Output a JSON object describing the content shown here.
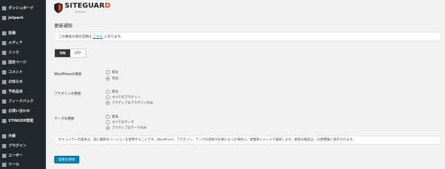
{
  "sidebar": {
    "items": [
      {
        "label": "ダッシュボード",
        "icon": "dashboard-icon"
      },
      {
        "label": "Jetpack",
        "icon": "jetpack-icon"
      },
      {
        "label": "投稿",
        "icon": "pin-icon"
      },
      {
        "label": "メディア",
        "icon": "media-icon"
      },
      {
        "label": "リンク",
        "icon": "link-icon"
      },
      {
        "label": "固定ページ",
        "icon": "page-icon"
      },
      {
        "label": "コメント",
        "icon": "comment-icon"
      },
      {
        "label": "お知らせ",
        "icon": "pin-icon"
      },
      {
        "label": "予約品目",
        "icon": "pin-icon"
      },
      {
        "label": "フィードバック",
        "icon": "feedback-icon"
      },
      {
        "label": "お問い合わせ",
        "icon": "mail-icon"
      },
      {
        "label": "STINGER管理",
        "icon": "settings-icon"
      },
      {
        "label": "外観",
        "icon": "brush-icon"
      },
      {
        "label": "プラグイン",
        "icon": "plugin-icon"
      },
      {
        "label": "ユーザー",
        "icon": "user-icon"
      },
      {
        "label": "ツール",
        "icon": "tools-icon"
      }
    ]
  },
  "logo": {
    "brand_main": "SITEGUAR",
    "brand_last": "D",
    "sub": "WP Plugin"
  },
  "page": {
    "title": "更新通知",
    "info_prefix": "この機能の操作説明は",
    "info_link": "こちら",
    "info_suffix": "にあります。"
  },
  "toggle": {
    "on": "ON",
    "off": "OFF",
    "selected": "ON"
  },
  "sections": {
    "wordpress": {
      "label": "WordPressの更新",
      "options": [
        {
          "label": "無効",
          "checked": false
        },
        {
          "label": "有効",
          "checked": true
        }
      ]
    },
    "plugin": {
      "label": "プラグインの更新",
      "options": [
        {
          "label": "無効",
          "checked": false
        },
        {
          "label": "すべてのプラグイン",
          "checked": false
        },
        {
          "label": "アクティブなプラグインのみ",
          "checked": true
        }
      ]
    },
    "theme": {
      "label": "テーマの更新",
      "options": [
        {
          "label": "無効",
          "checked": false
        },
        {
          "label": "すべてのテーマ",
          "checked": false
        },
        {
          "label": "アクティブなテーマのみ",
          "checked": true
        }
      ]
    }
  },
  "note": "セキュリティの基本は、常に最新のバージョンを使用することです。WordPress、プラグイン、テーマの更新が必要になった場合に、管理者にメールで通知します。更新の確認は、24時間毎に実行されます。",
  "save_label": "変更を保存",
  "colors": {
    "sidebar_bg": "#23282d",
    "accent": "#0085ba",
    "link": "#0073aa",
    "brand_accent": "#d54e21"
  }
}
